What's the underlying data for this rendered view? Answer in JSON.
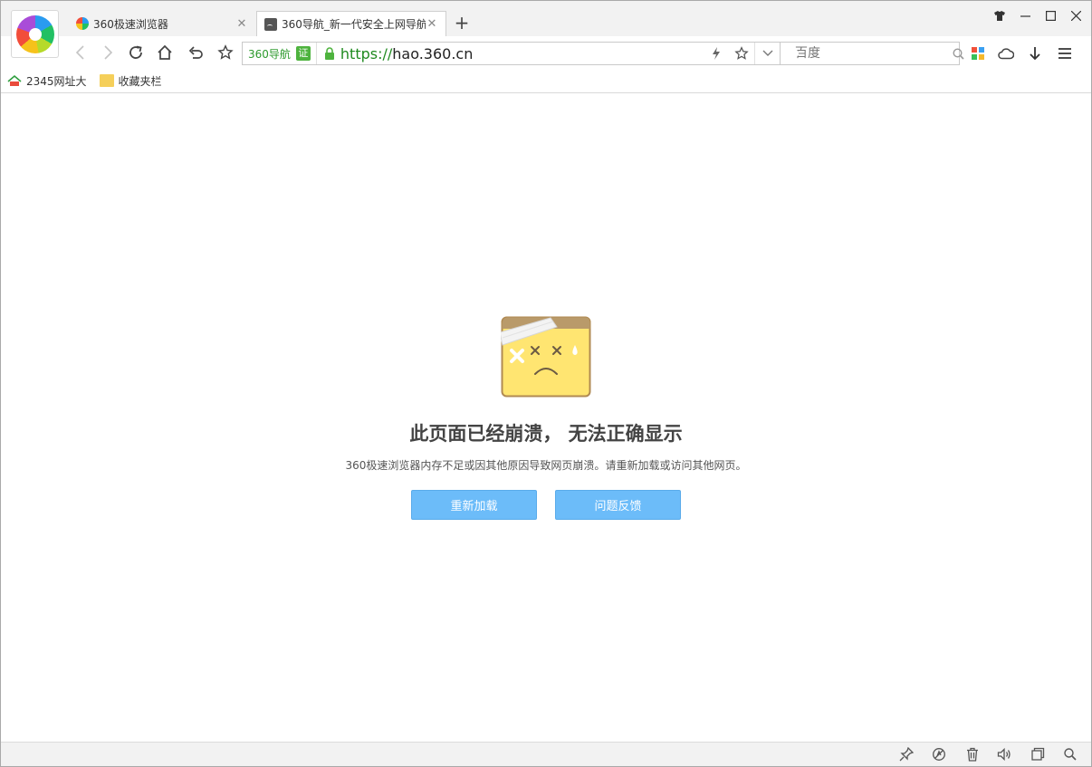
{
  "tabs": [
    {
      "title": "360极速浏览器",
      "icon": "pinwheel-icon"
    },
    {
      "title": "360导航_新一代安全上网导航",
      "icon": "sad-page-icon"
    }
  ],
  "address": {
    "site_label": "360导航",
    "cert_label": "证",
    "scheme": "https://",
    "host": "hao.360.cn"
  },
  "search": {
    "engine_icon": "baidu-icon",
    "placeholder": "百度"
  },
  "bookmarks": [
    {
      "label": "2345网址大",
      "icon": "2345-icon"
    },
    {
      "label": "收藏夹栏",
      "icon": "folder-icon"
    }
  ],
  "crash": {
    "title": "此页面已经崩溃， 无法正确显示",
    "description": "360极速浏览器内存不足或因其他原因导致网页崩溃。请重新加载或访问其他网页。",
    "reload_label": "重新加载",
    "feedback_label": "问题反馈"
  },
  "colors": {
    "button": "#6cbcf9",
    "url_scheme": "#1f8a1f",
    "cert": "#4eb33e"
  }
}
